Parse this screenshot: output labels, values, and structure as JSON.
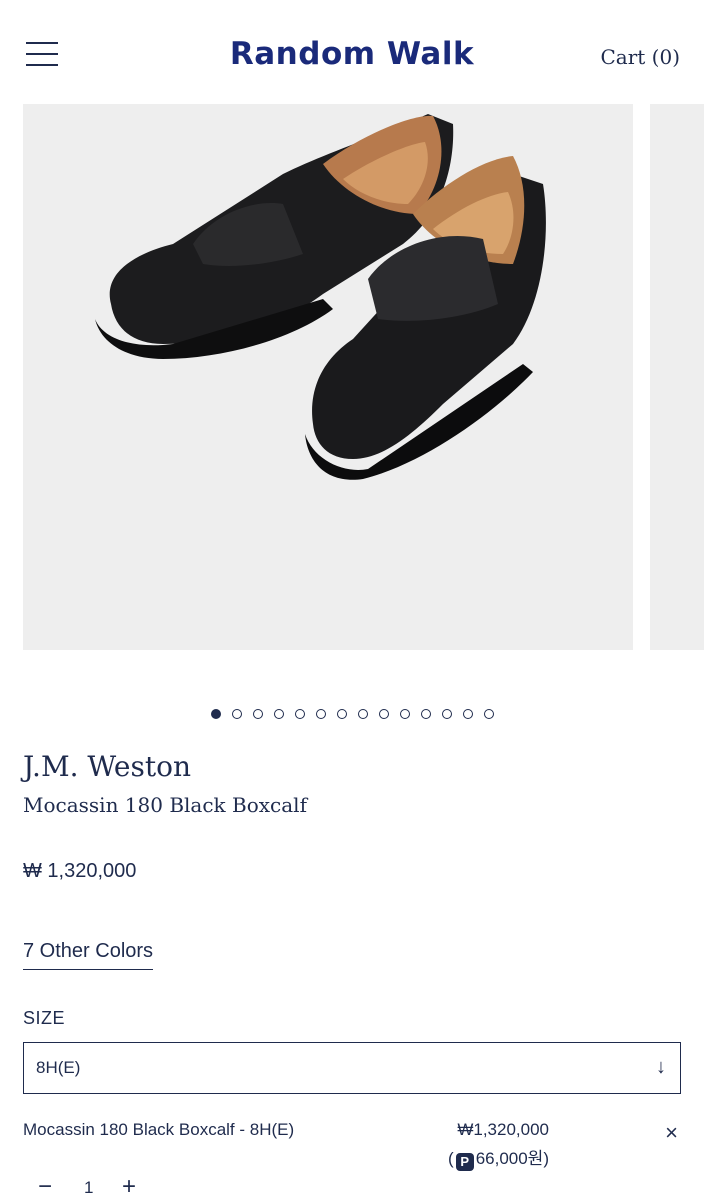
{
  "header": {
    "logo": "Random Walk",
    "cart_label": "Cart (0)"
  },
  "gallery": {
    "total_images": 14,
    "active_index": 0,
    "image_subject": "black penny loafer shoes"
  },
  "product": {
    "brand": "J.M. Weston",
    "name": "Mocassin 180 Black Boxcalf",
    "price": "₩ 1,320,000",
    "other_colors": "7 Other Colors"
  },
  "size": {
    "label": "SIZE",
    "selected": "8H(E)",
    "arrow": "↓"
  },
  "selection": {
    "name": "Mocassin 180 Black Boxcalf - 8H(E)",
    "price": "₩1,320,000",
    "points_prefix": "(",
    "points_icon": "P",
    "points_value": "66,000원)",
    "quantity": "1",
    "minus": "−",
    "plus": "+",
    "remove": "×"
  },
  "colors": {
    "brand": "#1f2b4d",
    "logo": "#1a2a7a",
    "image_bg": "#eeeeee"
  }
}
